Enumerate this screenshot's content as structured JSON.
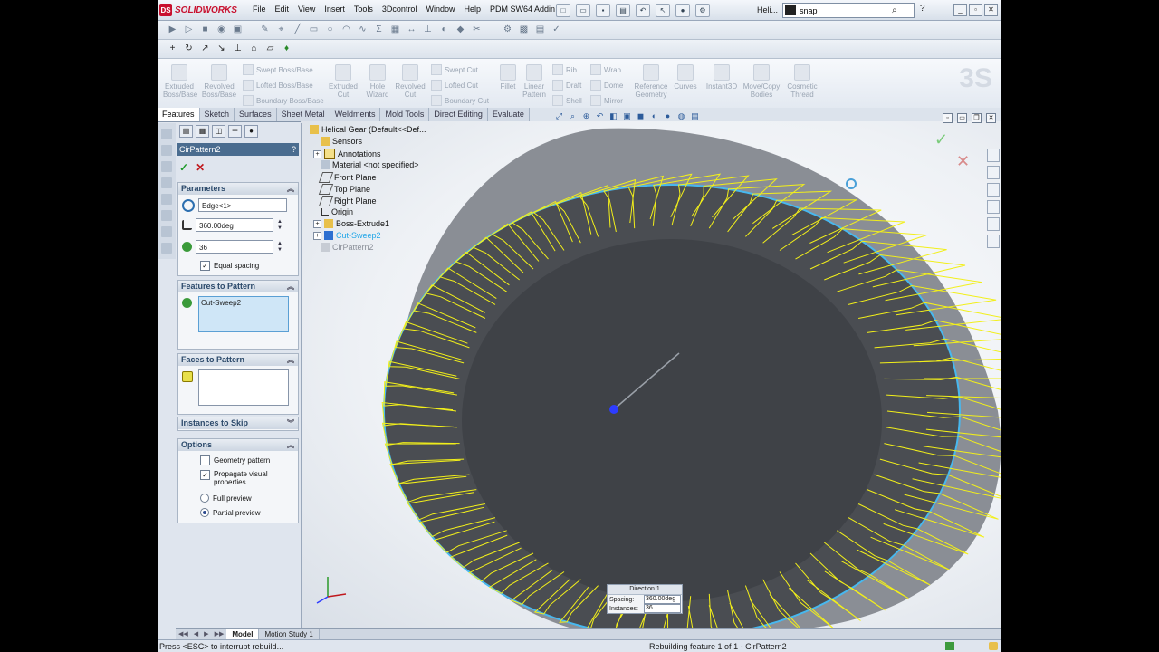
{
  "app": {
    "logo_text": "SOLIDWORKS",
    "doc_title": "Heli..."
  },
  "menu": [
    "File",
    "Edit",
    "View",
    "Insert",
    "Tools",
    "3Dcontrol",
    "Window",
    "Help",
    "PDM SW64 Addin"
  ],
  "search": {
    "value": "snap"
  },
  "command_manager": {
    "extruded_boss": "Extruded\nBoss/Base",
    "revolved_boss": "Revolved\nBoss/Base",
    "swept_boss": "Swept Boss/Base",
    "lofted_boss": "Lofted Boss/Base",
    "boundary_boss": "Boundary Boss/Base",
    "extruded_cut": "Extruded\nCut",
    "hole_wizard": "Hole\nWizard",
    "revolved_cut": "Revolved\nCut",
    "swept_cut": "Swept Cut",
    "lofted_cut": "Lofted Cut",
    "boundary_cut": "Boundary Cut",
    "fillet": "Fillet",
    "linear_pattern": "Linear\nPattern",
    "rib": "Rib",
    "wrap": "Wrap",
    "draft": "Draft",
    "dome": "Dome",
    "shell": "Shell",
    "mirror": "Mirror",
    "reference_geometry": "Reference\nGeometry",
    "curves": "Curves",
    "instant3d": "Instant3D",
    "move_copy": "Move/Copy\nBodies",
    "cosmetic_thread": "Cosmetic\nThread"
  },
  "tabs": [
    "Features",
    "Sketch",
    "Surfaces",
    "Sheet Metal",
    "Weldments",
    "Mold Tools",
    "Direct Editing",
    "Evaluate"
  ],
  "property_manager": {
    "title": "CirPattern2",
    "parameters": {
      "header": "Parameters",
      "axis": "Edge<1>",
      "angle": "360.00deg",
      "instances": "36",
      "equal_spacing": "Equal spacing"
    },
    "features_to_pattern": {
      "header": "Features to Pattern",
      "items": [
        "Cut-Sweep2"
      ]
    },
    "faces_to_pattern": {
      "header": "Faces to Pattern"
    },
    "instances_to_skip": {
      "header": "Instances to Skip"
    },
    "options": {
      "header": "Options",
      "geometry_pattern": "Geometry pattern",
      "propagate": "Propagate visual\nproperties",
      "full_preview": "Full preview",
      "partial_preview": "Partial preview"
    }
  },
  "feature_tree": [
    "Helical Gear  (Default<<Def...",
    "Sensors",
    "Annotations",
    "Material <not specified>",
    "Front Plane",
    "Top Plane",
    "Right Plane",
    "Origin",
    "Boss-Extrude1",
    "Cut-Sweep2",
    "CirPattern2"
  ],
  "callout": {
    "title": "Direction 1",
    "spacing_label": "Spacing:",
    "spacing_value": "360.00deg",
    "instances_label": "Instances:",
    "instances_value": "36"
  },
  "bottom_tabs": [
    "Model",
    "Motion Study 1"
  ],
  "status": {
    "left": "Press <ESC> to interrupt rebuild...",
    "right": "Rebuilding feature 1 of 1 - CirPattern2"
  },
  "colors": {
    "tooth_wireframe": "#f2ef1a",
    "gear_face": "#4a4d52",
    "gear_rim": "#8a8e95",
    "edge_highlight": "#47b8ef"
  }
}
